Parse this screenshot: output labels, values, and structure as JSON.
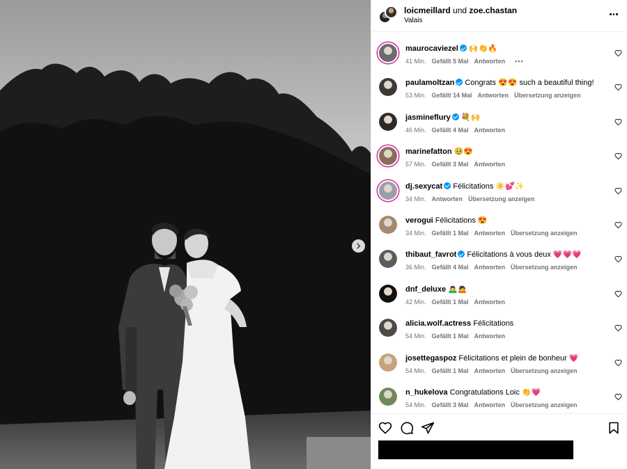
{
  "post": {
    "authors": {
      "first": "loicmeillard",
      "joiner": "und",
      "second": "zoe.chastan"
    },
    "location": "Valais",
    "more_icon": "more-horizontal-icon",
    "next_icon": "chevron-right-icon"
  },
  "comments": [
    {
      "user": "maurocaviezel",
      "verified": true,
      "text": "🙌👏🔥",
      "time": "41 Min.",
      "likes": "Gefällt 5 Mal",
      "reply": "Antworten",
      "translate": "",
      "more": "•••",
      "ring": true,
      "avatar": "#6b6b6b"
    },
    {
      "user": "paulamoltzan",
      "verified": true,
      "text": "Congrats 😍😍 such a beautiful thing!",
      "time": "53 Min.",
      "likes": "Gefällt 14 Mal",
      "reply": "Antworten",
      "translate": "Übersetzung anzeigen",
      "more": "",
      "ring": false,
      "avatar": "#3a3a3a"
    },
    {
      "user": "jasmineflury",
      "verified": true,
      "text": "💐🙌",
      "time": "46 Min.",
      "likes": "Gefällt 4 Mal",
      "reply": "Antworten",
      "translate": "",
      "more": "",
      "ring": false,
      "avatar": "#2a2a2a"
    },
    {
      "user": "marinefatton",
      "verified": false,
      "text": "🥹😍",
      "time": "57 Min.",
      "likes": "Gefällt 3 Mal",
      "reply": "Antworten",
      "translate": "",
      "more": "",
      "ring": true,
      "avatar": "#8a6e5a"
    },
    {
      "user": "dj.sexycat",
      "verified": true,
      "text": "Félicitations ☀️💕✨",
      "time": "34 Min.",
      "likes": "",
      "reply": "Antworten",
      "translate": "Übersetzung anzeigen",
      "more": "",
      "ring": true,
      "avatar": "#9aa0a8"
    },
    {
      "user": "verogui",
      "verified": false,
      "text": "Félicitations 😍",
      "time": "34 Min.",
      "likes": "Gefällt 1 Mal",
      "reply": "Antworten",
      "translate": "Übersetzung anzeigen",
      "more": "",
      "ring": false,
      "avatar": "#a38a6e"
    },
    {
      "user": "thibaut_favrot",
      "verified": true,
      "text": "Félicitations à vous deux 💗💗💗",
      "time": "36 Min.",
      "likes": "Gefällt 4 Mal",
      "reply": "Antworten",
      "translate": "Übersetzung anzeigen",
      "more": "",
      "ring": false,
      "avatar": "#5c5c5c"
    },
    {
      "user": "dnf_deluxe",
      "verified": false,
      "text": "🙇‍♂️🙇",
      "time": "42 Min.",
      "likes": "Gefällt 1 Mal",
      "reply": "Antworten",
      "translate": "",
      "more": "",
      "ring": false,
      "avatar": "#111111"
    },
    {
      "user": "alicia.wolf.actress",
      "verified": false,
      "text": "Félicitations",
      "time": "54 Min.",
      "likes": "Gefällt 1 Mal",
      "reply": "Antworten",
      "translate": "",
      "more": "",
      "ring": false,
      "avatar": "#4a4a4a"
    },
    {
      "user": "josettegaspoz",
      "verified": false,
      "text": "Félicitations et plein de bonheur 💗",
      "time": "54 Min.",
      "likes": "Gefällt 1 Mal",
      "reply": "Antworten",
      "translate": "Übersetzung anzeigen",
      "more": "",
      "ring": false,
      "avatar": "#c7a27a"
    },
    {
      "user": "n_hukelova",
      "verified": false,
      "text": "Congratulations Loic 👏💗",
      "time": "54 Min.",
      "likes": "Gefällt 3 Mal",
      "reply": "Antworten",
      "translate": "Übersetzung anzeigen",
      "more": "",
      "ring": false,
      "avatar": "#6f8a5a"
    }
  ],
  "actions": {
    "like_icon": "heart-icon",
    "comment_icon": "comment-icon",
    "share_icon": "share-icon",
    "save_icon": "bookmark-icon"
  }
}
